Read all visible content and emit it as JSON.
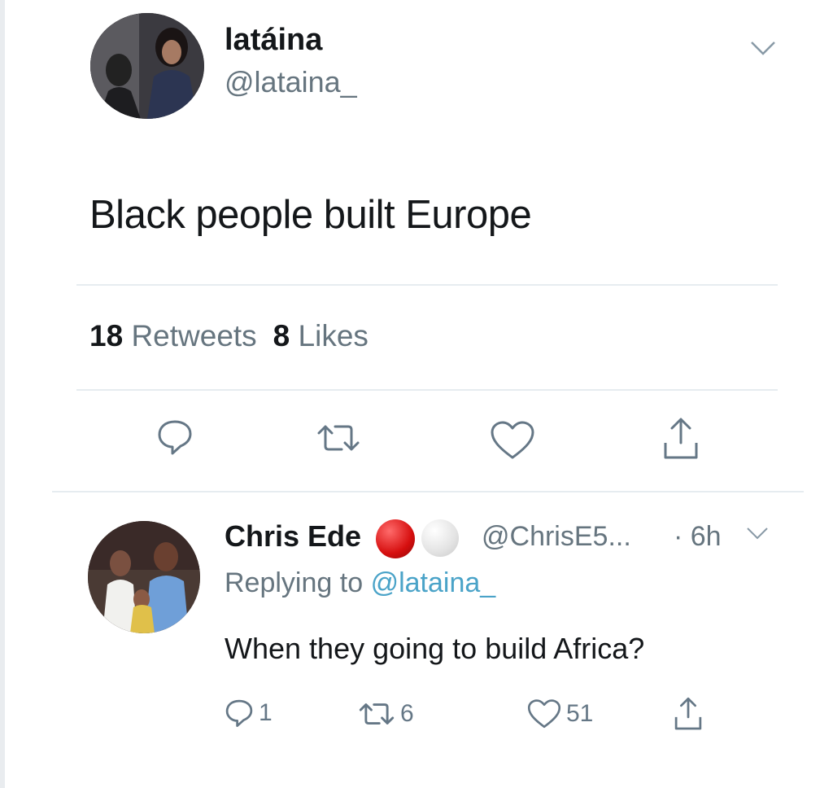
{
  "tweet": {
    "display_name": "latáina",
    "handle": "@lataina_",
    "text": "Black people built Europe",
    "retweets_count": "18",
    "retweets_label": "Retweets",
    "likes_count": "8",
    "likes_label": "Likes"
  },
  "reply": {
    "display_name": "Chris Ede",
    "handle": "@ChrisE5...",
    "time": "· 6h",
    "replying_prefix": "Replying to",
    "replying_mention": "@lataina_",
    "text": "When they going to build Africa?",
    "reply_count": "1",
    "retweet_count": "6",
    "like_count": "51"
  },
  "icons": {
    "main_actions": [
      "reply-icon",
      "retweet-icon",
      "like-icon",
      "share-icon"
    ],
    "reply_actions": [
      "reply-icon",
      "retweet-icon",
      "like-icon",
      "share-icon"
    ],
    "menu": "chevron-down-icon"
  },
  "colors": {
    "text": "#14171a",
    "secondary": "#66757f",
    "mention": "#4aa3c8",
    "badge_red": "#d60f0f",
    "divider": "#e6ecf0"
  }
}
